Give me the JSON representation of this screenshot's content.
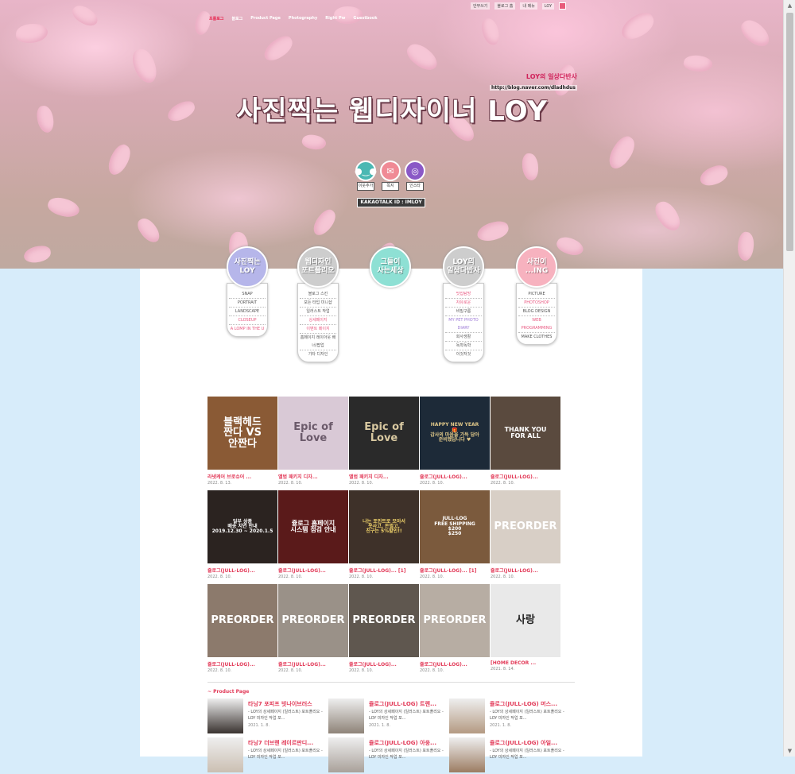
{
  "nav": {
    "items": [
      "프롤로그",
      "블로그",
      "Product Page",
      "Photography",
      "Right Pw",
      "Guestbook"
    ]
  },
  "util": {
    "items": [
      "안부쓰기",
      "블로그 홈",
      "내 메뉴",
      "LOY"
    ]
  },
  "blog": {
    "subtitle": "LOY의 일상다반사",
    "url": "http://blog.naver.com/dladhdus",
    "title": "사진찍는 웹디자이너 LOY"
  },
  "social": [
    {
      "label": "이웃추가",
      "icon": "kakao-friend-icon",
      "color": "#4ab8b3",
      "glyph": "●‿●"
    },
    {
      "label": "쪽지",
      "icon": "mail-icon",
      "color": "#f08a95",
      "glyph": "✉"
    },
    {
      "label": "인스타",
      "icon": "instagram-icon",
      "color": "#8a58c6",
      "glyph": "◎"
    }
  ],
  "kakao_id": "KAKAOTALK ID : IMLOY",
  "categories": [
    {
      "title": "사진찍는\nLOY",
      "color": "#b6b6ea",
      "items": [
        "SNAP",
        "PORTRAIT",
        "LANDSCAPE",
        "CLOSEUP",
        "A LOMP IN THE U"
      ]
    },
    {
      "title": "웹디자인\n포트폴리오",
      "color": "#cdcdcd",
      "items": [
        "블로그 스킨",
        "모든 타입 미니샵",
        "일러스트 작업",
        "상세페이지",
        "이벤트 페이지",
        "홈페이지 레이아웃 배너/팝업",
        "기타 디자인"
      ]
    },
    {
      "title": "그들이\n사는세상",
      "color": "#8ee0d4",
      "items": []
    },
    {
      "title": "LOY의\n일상다반사",
      "color": "#cdcdcd",
      "items": [
        "맛집탐방",
        "자유로운",
        "비밀구름",
        "MY PET PHOTO DIARY",
        "회사생활",
        "독학독학",
        "이것저것"
      ]
    },
    {
      "title": "사진이\n...ING",
      "color": "#f7b2bf",
      "items": [
        "PICTURE",
        "PHOTOSHOP",
        "BLOG DESIGN",
        "WEB PROGRAMMING",
        "MAKE CLOTHES"
      ]
    }
  ],
  "posts": [
    {
      "title": "라넷케어 브로슈어 ...",
      "date": "2022. 8. 13.",
      "thumb_text": "블랙헤드\n짠다 VS\n안짠다",
      "bg": "#8a5a35",
      "fg": "#ffffff"
    },
    {
      "title": "앨범 패키지 디자...",
      "date": "2022. 8. 10.",
      "thumb_text": "Epic of Love",
      "bg": "#d9c9d6",
      "fg": "#6b5a6a"
    },
    {
      "title": "앨범 패키지 디자...",
      "date": "2022. 8. 10.",
      "thumb_text": "Epic of Love",
      "bg": "#2a2a2a",
      "fg": "#d8c8a0"
    },
    {
      "title": "쥴로그(JULL-LOG)...",
      "date": "2022. 8. 10.",
      "thumb_text": "HAPPY NEW YEAR\n🎁\n감사의 마음을 가득 담아\n준비했답니다 ♥",
      "bg": "#1d2a38",
      "fg": "#e0c889"
    },
    {
      "title": "쥴로그(JULL-LOG)...",
      "date": "2022. 8. 10.",
      "thumb_text": "THANK YOU\nFOR ALL",
      "bg": "#5a4a3e",
      "fg": "#ffffff"
    },
    {
      "title": "쥴로그(JULL-LOG)...",
      "date": "2022. 8. 10.",
      "thumb_text": "일부 상품\n배송 지연 안내\n2019.12.30 ~ 2020.1.5",
      "bg": "#2b2320",
      "fg": "#ffffff"
    },
    {
      "title": "쥴로그(JULL-LOG)...",
      "date": "2022. 8. 10.",
      "thumb_text": "쥴로그 홈페이지\n시스템 점검 안내",
      "bg": "#5a1a1a",
      "fg": "#ffffff"
    },
    {
      "title": "쥴로그(JULL-LOG)... [1]",
      "date": "2022. 8. 10.",
      "thumb_text": "나는 포인트로 모아서\n옷사고, 돈벌고,\n친구는 5%할인!!",
      "bg": "#3e3129",
      "fg": "#f0d36a"
    },
    {
      "title": "쥴로그(JULL-LOG)... [1]",
      "date": "2022. 8. 10.",
      "thumb_text": "JULL-LOG\nFREE SHIPPING\n$200\n$250",
      "bg": "#7b5a3d",
      "fg": "#ffffff"
    },
    {
      "title": "쥴로그(JULL-LOG)...",
      "date": "2022. 8. 10.",
      "thumb_text": "PREORDER",
      "bg": "#d8cfc6",
      "fg": "#ffffff"
    },
    {
      "title": "쥴로그(JULL-LOG)...",
      "date": "2022. 8. 10.",
      "thumb_text": "PREORDER",
      "bg": "#8c7a6c",
      "fg": "#ffffff"
    },
    {
      "title": "쥴로그(JULL-LOG)...",
      "date": "2022. 8. 10.",
      "thumb_text": "PREORDER",
      "bg": "#9a9188",
      "fg": "#ffffff"
    },
    {
      "title": "쥴로그(JULL-LOG)...",
      "date": "2022. 8. 10.",
      "thumb_text": "PREORDER",
      "bg": "#5f574f",
      "fg": "#ffffff"
    },
    {
      "title": "쥴로그(JULL-LOG)...",
      "date": "2022. 8. 10.",
      "thumb_text": "PREORDER",
      "bg": "#b7ada3",
      "fg": "#ffffff"
    },
    {
      "title": "[HOME DECOR ...",
      "date": "2021. 8. 14.",
      "thumb_text": "사랑",
      "bg": "#e9e9e9",
      "fg": "#222222"
    }
  ],
  "product_section": {
    "heading": "~ Product Page",
    "items": [
      {
        "title": "타닝7 포피프 빗나이브러스",
        "desc": "- LOY의 상세페이지 (일러스트) 포트폴리오 - LOY 미자인 작업 포...",
        "date": "2021. 1. 8.",
        "bg": "#3a3330"
      },
      {
        "title": "쥴로그(JULL-LOG) 트렌...",
        "desc": "- LOY의 상세페이지 (일러스트) 포트폴리오 - LOY 미자인 작업 포...",
        "date": "2021. 1. 8.",
        "bg": "#8e8378"
      },
      {
        "title": "쥴로그(JULL-LOG) 머스...",
        "desc": "- LOY의 상세페이지 (일러스트) 포트폴리오 - LOY 미자인 작업 포...",
        "date": "2021. 1. 8.",
        "bg": "#b49a82"
      },
      {
        "title": "타닝7 더브렌 레이르판디...",
        "desc": "- LOY의 상세페이지 (일러스트) 포트폴리오 - LOY 미자인 작업 포...",
        "date": "",
        "bg": "#cbbfb2"
      },
      {
        "title": "쥴로그(JULL-LOG) 아웅...",
        "desc": "- LOY의 상세페이지 (일러스트) 포트폴리오 - LOY 미자인 작업 포...",
        "date": "",
        "bg": "#a9a19a"
      },
      {
        "title": "쥴로그(JULL-LOG) 아일...",
        "desc": "- LOY의 상세페이지 (일러스트) 포트폴리오 - LOY 미자인 작업 포...",
        "date": "",
        "bg": "#9c7c62"
      }
    ]
  }
}
